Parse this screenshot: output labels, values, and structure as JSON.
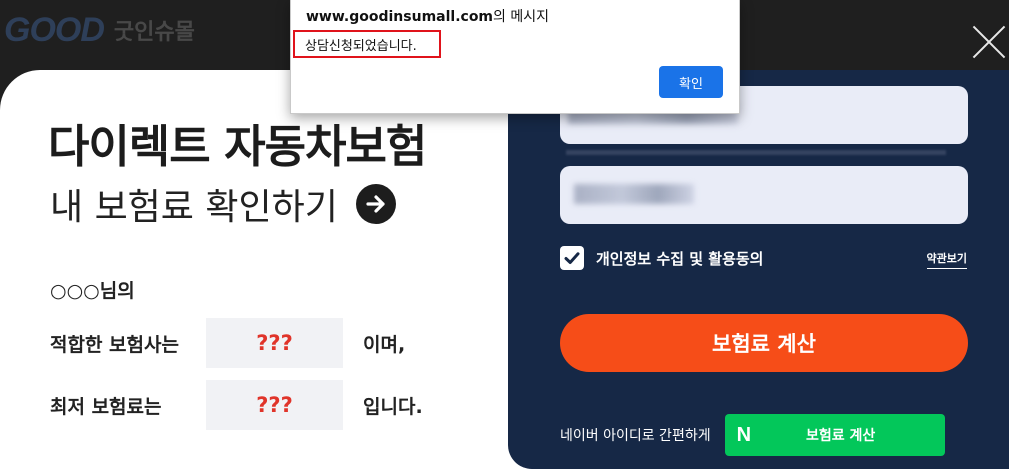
{
  "header": {
    "logo_mark": "GOOD",
    "logo_text": "굿인슈몰"
  },
  "left": {
    "title": "다이렉트 자동차보험",
    "subtitle": "내 보험료 확인하기",
    "customer_line": "○○○님의",
    "row1": {
      "label": "적합한 보험사는",
      "value": "???",
      "suffix": "이며,"
    },
    "row2": {
      "label": "최저 보험료는",
      "value": "???",
      "suffix": "입니다."
    }
  },
  "right": {
    "consent_label": "개인정보 수집 및 활용동의",
    "terms_link": "약관보기",
    "calc_button": "보험료 계산",
    "naver_label": "네이버 아이디로 간편하게",
    "naver_icon": "N",
    "naver_button": "보험료 계산"
  },
  "alert": {
    "site": "www.goodinsumall.com",
    "title_suffix": "의 메시지",
    "message": "상담신청되었습니다.",
    "ok_label": "확인"
  },
  "colors": {
    "accent_orange": "#f64d18",
    "navy_panel": "#162846",
    "naver_green": "#03c75a",
    "value_red": "#e0342a",
    "alert_button": "#1a73e8"
  },
  "icons": [
    "close-icon",
    "arrow-right-icon",
    "checkbox-checked-icon",
    "naver-n-icon"
  ]
}
